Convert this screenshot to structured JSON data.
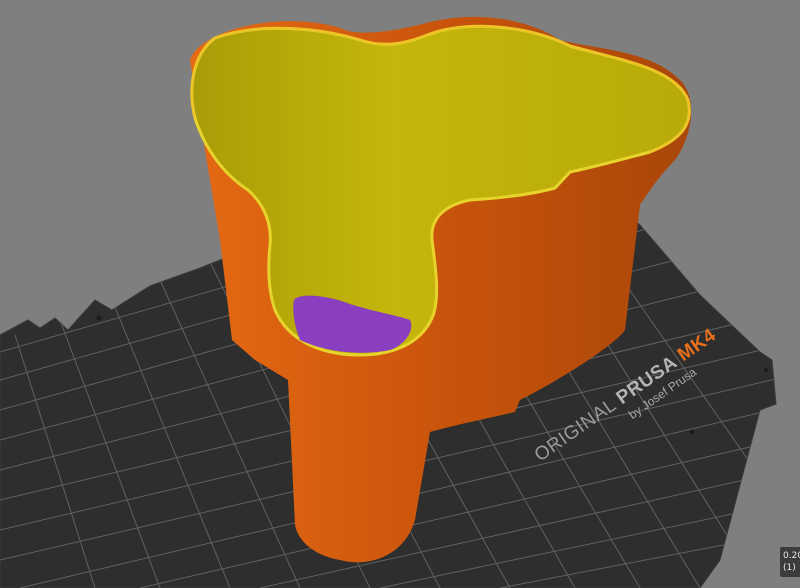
{
  "bed": {
    "brand_prefix": "ORIGINAL",
    "brand_name": "PRUSA",
    "brand_model": "MK4",
    "byline": "by Josef Prusa"
  },
  "legend": {
    "layer_height": "0.20",
    "extruder": "(1)"
  },
  "colors": {
    "background": "#7f7f7f",
    "bed": "#2d2d2d",
    "grid": "#707070",
    "model_outer": "#cf5a0e",
    "model_inner": "#c2b50a",
    "model_floor": "#8a3fc0",
    "brand_accent": "#e86f1b"
  }
}
